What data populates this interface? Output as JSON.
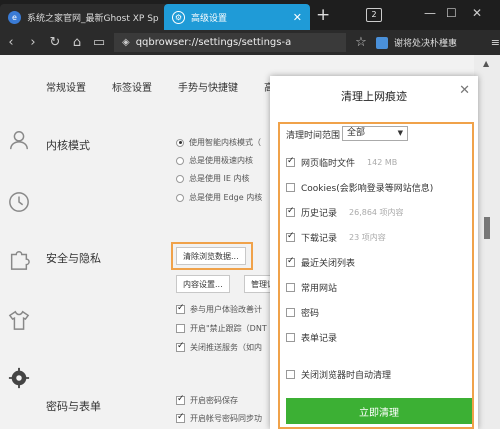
{
  "browser": {
    "tabs": [
      {
        "title": "系统之家官网_最新Ghost XP Sp",
        "active": false
      },
      {
        "title": "高级设置",
        "active": true
      }
    ],
    "new_tab_glyph": "+",
    "tab_count": "2",
    "address": "qqbrowser://settings/settings-a",
    "right_text": "谢将处决朴槿惠"
  },
  "settings": {
    "tabs": [
      "常规设置",
      "标签设置",
      "手势与快捷键",
      "高"
    ],
    "sections": {
      "kernel": {
        "title": "内核模式",
        "options": [
          {
            "label": "使用智能内核模式（",
            "selected": true
          },
          {
            "label": "总是使用极速内核",
            "selected": false
          },
          {
            "label": "总是使用 IE 内核",
            "selected": false
          },
          {
            "label": "总是使用 Edge 内核",
            "selected": false
          }
        ]
      },
      "privacy": {
        "title": "安全与隐私",
        "clear_button": "清除浏览数据...",
        "content_button": "内容设置...",
        "manage_button": "管理证",
        "checks": [
          {
            "label": "参与用户体验改善计",
            "checked": true
          },
          {
            "label": "开启\"禁止跟踪（DNT",
            "checked": false
          },
          {
            "label": "关闭推送服务（如内",
            "checked": true
          }
        ]
      },
      "password": {
        "title": "密码与表单",
        "checks": [
          {
            "label": "开启密码保存",
            "checked": true
          },
          {
            "label": "开启帐号密码同步功",
            "checked": true
          }
        ]
      }
    }
  },
  "dialog": {
    "title": "清理上网痕迹",
    "range_label": "清理时间范围",
    "range_value": "全部",
    "items": [
      {
        "label": "网页临时文件",
        "meta": "142 MB",
        "checked": true
      },
      {
        "label": "Cookies(会影响登录等网站信息)",
        "meta": "",
        "checked": false
      },
      {
        "label": "历史记录",
        "meta": "26,864 项内容",
        "checked": true
      },
      {
        "label": "下载记录",
        "meta": "23 项内容",
        "checked": true
      },
      {
        "label": "最近关闭列表",
        "meta": "",
        "checked": true
      },
      {
        "label": "常用网站",
        "meta": "",
        "checked": false
      },
      {
        "label": "密码",
        "meta": "",
        "checked": false
      },
      {
        "label": "表单记录",
        "meta": "",
        "checked": false
      }
    ],
    "auto_clear_label": "关闭浏览器时自动清理",
    "auto_clear_checked": false,
    "confirm_button": "立即清理"
  },
  "colors": {
    "accent_tab": "#1f9bd7",
    "highlight": "#f0a24a",
    "confirm_green": "#3cb034"
  }
}
